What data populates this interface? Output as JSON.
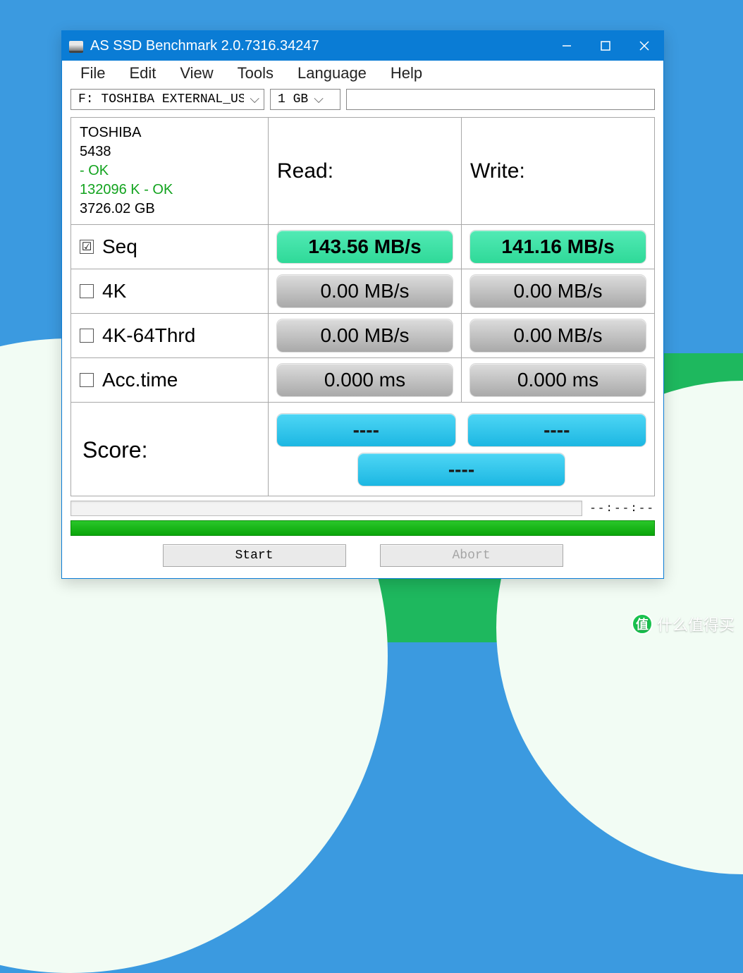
{
  "window": {
    "title": "AS SSD Benchmark 2.0.7316.34247"
  },
  "menu": [
    "File",
    "Edit",
    "View",
    "Tools",
    "Language",
    "Help"
  ],
  "toolbar": {
    "drive": "F: TOSHIBA EXTERNAL_USB USB Devic",
    "size": "1 GB"
  },
  "device": {
    "name": "TOSHIBA",
    "model": "5438",
    "status1": " - OK",
    "status2": "132096 K - OK",
    "capacity": "3726.02 GB"
  },
  "headers": {
    "read": "Read:",
    "write": "Write:"
  },
  "tests": [
    {
      "label": "Seq",
      "checked": true,
      "read": "143.56 MB/s",
      "write": "141.16 MB/s",
      "style": "green"
    },
    {
      "label": "4K",
      "checked": false,
      "read": "0.00 MB/s",
      "write": "0.00 MB/s",
      "style": "gray"
    },
    {
      "label": "4K-64Thrd",
      "checked": false,
      "read": "0.00 MB/s",
      "write": "0.00 MB/s",
      "style": "gray"
    },
    {
      "label": "Acc.time",
      "checked": false,
      "read": "0.000 ms",
      "write": "0.000 ms",
      "style": "gray"
    }
  ],
  "score": {
    "label": "Score:",
    "read": "----",
    "write": "----",
    "total": "----"
  },
  "progress": {
    "time": "--:--:--"
  },
  "buttons": {
    "start": "Start",
    "abort": "Abort"
  },
  "watermark": {
    "badge": "值",
    "text": "什么值得买"
  }
}
